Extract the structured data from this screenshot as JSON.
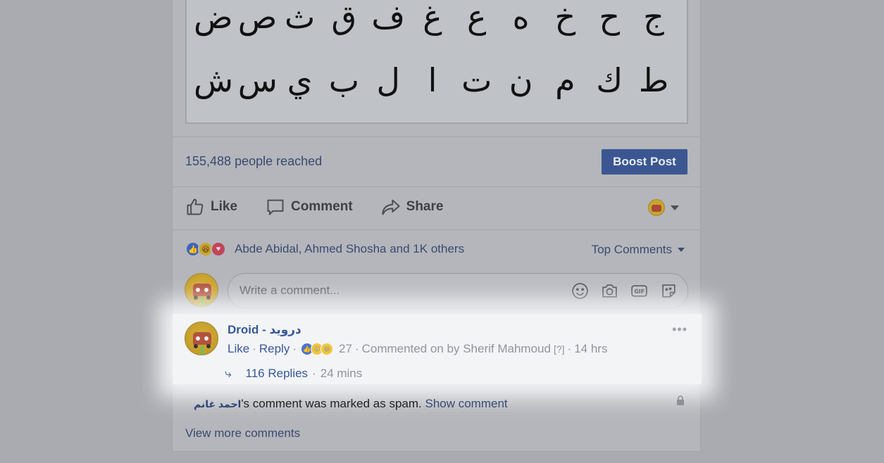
{
  "post_image": {
    "row1": [
      "ض",
      "ص",
      "ث",
      "ق",
      "ف",
      "غ",
      "ع",
      "ه",
      "خ",
      "ح",
      "ج"
    ],
    "row2": [
      "ش",
      "س",
      "ي",
      "ب",
      "ل",
      "ا",
      "ت",
      "ن",
      "م",
      "ك",
      "ط"
    ]
  },
  "stats": {
    "reach": "155,488 people reached",
    "boost_label": "Boost Post"
  },
  "actions": {
    "like": "Like",
    "comment": "Comment",
    "share": "Share"
  },
  "reactions": {
    "summary": "Abde Abidal, Ahmed Shosha and 1K others",
    "sort_label": "Top Comments"
  },
  "composer": {
    "placeholder": "Write a comment..."
  },
  "comment": {
    "author": "Droid - درويد",
    "more": "•••",
    "like": "Like",
    "reply": "Reply",
    "reaction_count": "27",
    "commented_on": "Commented on by Sherif Mahmoud",
    "help": "[?]",
    "time": "14 hrs",
    "replies": "116 Replies",
    "replies_time": "24 mins",
    "sep": "·"
  },
  "spam": {
    "author": "احمد غانم",
    "text": "'s comment was marked as spam.",
    "show": "Show comment"
  },
  "footer": {
    "view_more": "View more comments"
  },
  "colors": {
    "link": "#365899",
    "boost": "#3b5691"
  }
}
